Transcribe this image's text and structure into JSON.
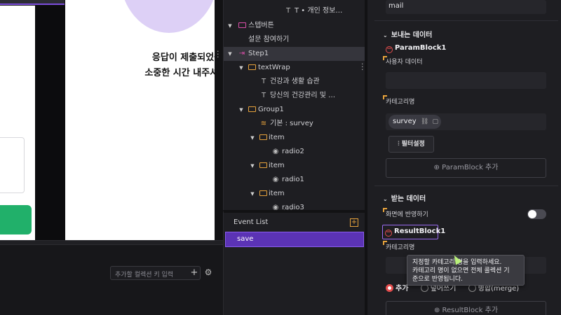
{
  "canvas": {
    "message_line1": "응답이 제출되었습니",
    "message_line2": "소중한 시간 내주셔서 감",
    "key_input_placeholder": "추가할 컬렉션 키 입력",
    "key_add_symbol": "+",
    "settings_icon": "gear-icon"
  },
  "tree": {
    "items": [
      {
        "label": "T • 개인 정보…"
      },
      {
        "label": "스텝버튼"
      },
      {
        "label": "설문 참여하기"
      },
      {
        "label": "Step1"
      },
      {
        "label": "textWrap"
      },
      {
        "label": "건강과 생활 습관"
      },
      {
        "label": "당신의 건강관리 및 …"
      },
      {
        "label": "Group1"
      },
      {
        "label": "기본 : survey"
      },
      {
        "label": "item"
      },
      {
        "label": "radio2"
      },
      {
        "label": "item"
      },
      {
        "label": "radio1"
      },
      {
        "label": "item"
      },
      {
        "label": "radio3"
      }
    ]
  },
  "events": {
    "title": "Event List",
    "add_symbol": "+",
    "items": [
      "save"
    ]
  },
  "props": {
    "mail_value": "mail",
    "send_section": "보내는 데이터",
    "param_block": "ParamBlock1",
    "user_data_label": "사용자 데이터",
    "category_label": "카테고리명",
    "chip_value": "survey",
    "filter_button": "필터설정",
    "add_param_button": "ParamBlock 추가",
    "receive_section": "받는 데이터",
    "reflect_label": "화면에 반영하기",
    "reflect_on": false,
    "result_block": "ResultBlock1",
    "category_label2": "카테고리명",
    "radio_options": [
      "추가",
      "덮어쓰기",
      "병합(merge)"
    ],
    "radio_selected": "추가",
    "add_result_button": "ResultBlock 추가"
  },
  "tooltip": {
    "line1": "지정할 카테고리 명을 입력하세요.",
    "line2": "카테고리 명이 없으면 전체 콜렉션 기",
    "line3": "준으로 반영됩니다."
  },
  "colors": {
    "accent": "#7c4ddc",
    "folder": "#e6a23c",
    "danger": "#e44d4d",
    "success": "#21b06a"
  }
}
